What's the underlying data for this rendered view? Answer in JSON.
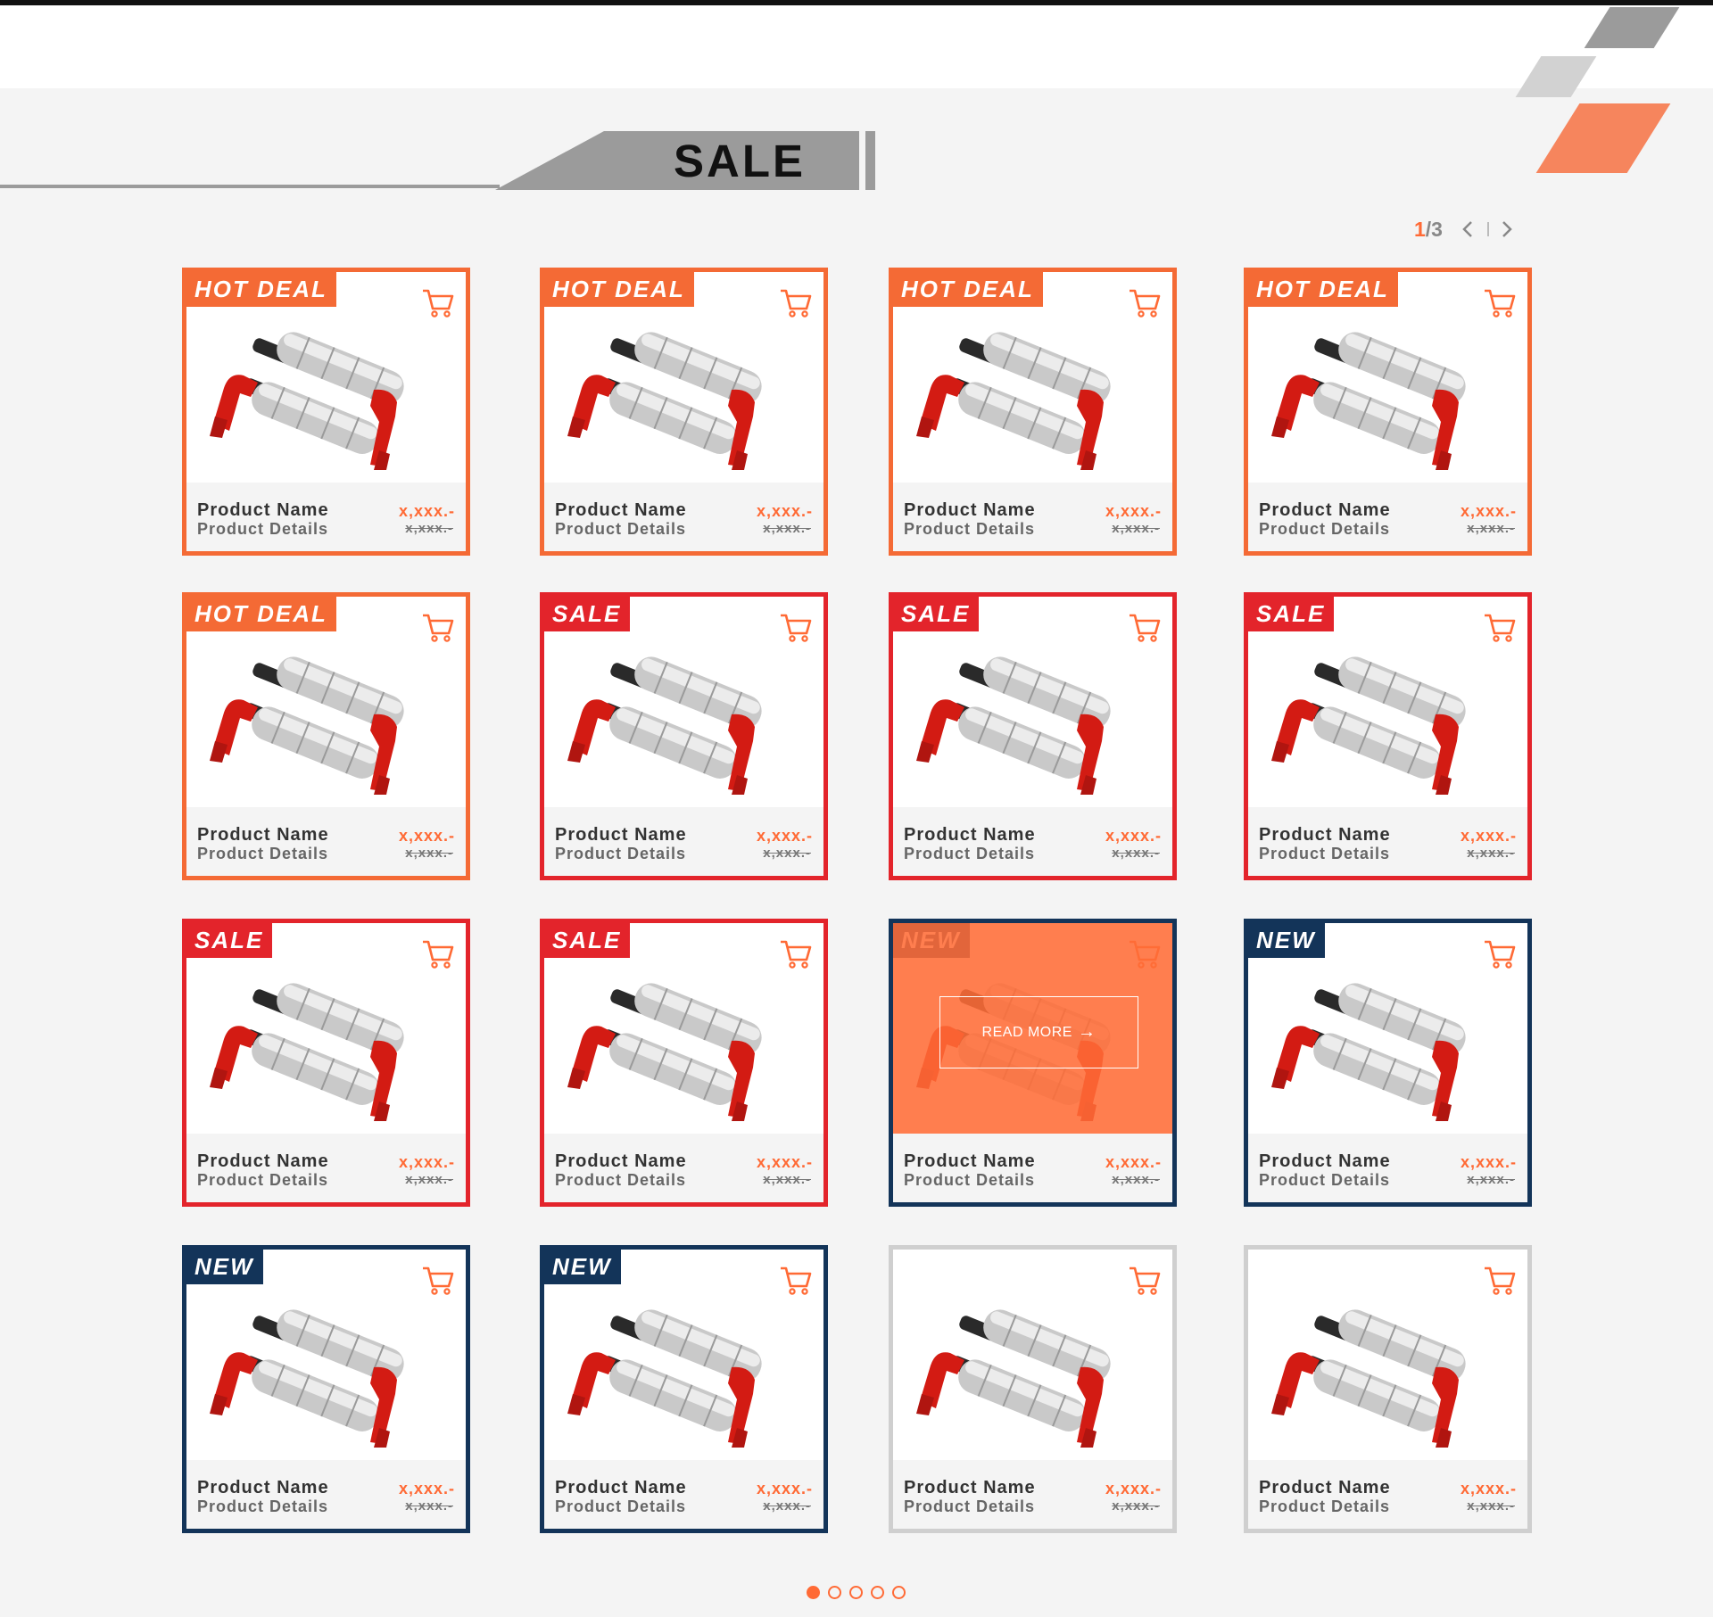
{
  "colors": {
    "accent": "#ff6a35",
    "hot": "#f46a35",
    "sale": "#e3242b",
    "new": "#133459",
    "plain": "#cfcfcf"
  },
  "header": {
    "title": "SALE"
  },
  "pager": {
    "current": "1",
    "total": "/3",
    "prev_icon": "chevron-left-icon",
    "next_icon": "chevron-right-icon"
  },
  "overlay": {
    "read_more": "READ MORE",
    "read_more_icon": "arrow-right-icon"
  },
  "cards": [
    {
      "tag": "hot",
      "badge": "HOT DEAL",
      "name": "Product Name",
      "details": "Product Details",
      "price": "x,xxx.-",
      "old_price": "x,xxx.-"
    },
    {
      "tag": "hot",
      "badge": "HOT DEAL",
      "name": "Product Name",
      "details": "Product Details",
      "price": "x,xxx.-",
      "old_price": "x,xxx.-"
    },
    {
      "tag": "hot",
      "badge": "HOT DEAL",
      "name": "Product Name",
      "details": "Product Details",
      "price": "x,xxx.-",
      "old_price": "x,xxx.-"
    },
    {
      "tag": "hot",
      "badge": "HOT DEAL",
      "name": "Product Name",
      "details": "Product Details",
      "price": "x,xxx.-",
      "old_price": "x,xxx.-"
    },
    {
      "tag": "hot",
      "badge": "HOT DEAL",
      "name": "Product Name",
      "details": "Product Details",
      "price": "x,xxx.-",
      "old_price": "x,xxx.-"
    },
    {
      "tag": "sale",
      "badge": "SALE",
      "name": "Product Name",
      "details": "Product Details",
      "price": "x,xxx.-",
      "old_price": "x,xxx.-"
    },
    {
      "tag": "sale",
      "badge": "SALE",
      "name": "Product Name",
      "details": "Product Details",
      "price": "x,xxx.-",
      "old_price": "x,xxx.-"
    },
    {
      "tag": "sale",
      "badge": "SALE",
      "name": "Product Name",
      "details": "Product Details",
      "price": "x,xxx.-",
      "old_price": "x,xxx.-"
    },
    {
      "tag": "sale",
      "badge": "SALE",
      "name": "Product Name",
      "details": "Product Details",
      "price": "x,xxx.-",
      "old_price": "x,xxx.-"
    },
    {
      "tag": "sale",
      "badge": "SALE",
      "name": "Product Name",
      "details": "Product Details",
      "price": "x,xxx.-",
      "old_price": "x,xxx.-"
    },
    {
      "tag": "new",
      "badge": "NEW",
      "name": "Product Name",
      "details": "Product Details",
      "price": "x,xxx.-",
      "old_price": "x,xxx.-",
      "hover": true
    },
    {
      "tag": "new",
      "badge": "NEW",
      "name": "Product Name",
      "details": "Product Details",
      "price": "x,xxx.-",
      "old_price": "x,xxx.-"
    },
    {
      "tag": "new",
      "badge": "NEW",
      "name": "Product Name",
      "details": "Product Details",
      "price": "x,xxx.-",
      "old_price": "x,xxx.-"
    },
    {
      "tag": "new",
      "badge": "NEW",
      "name": "Product Name",
      "details": "Product Details",
      "price": "x,xxx.-",
      "old_price": "x,xxx.-"
    },
    {
      "tag": "plain",
      "badge": "",
      "name": "Product Name",
      "details": "Product Details",
      "price": "x,xxx.-",
      "old_price": "x,xxx.-"
    },
    {
      "tag": "plain",
      "badge": "",
      "name": "Product Name",
      "details": "Product Details",
      "price": "x,xxx.-",
      "old_price": "x,xxx.-"
    }
  ],
  "carousel": {
    "pages": 5,
    "active_index": 0
  }
}
